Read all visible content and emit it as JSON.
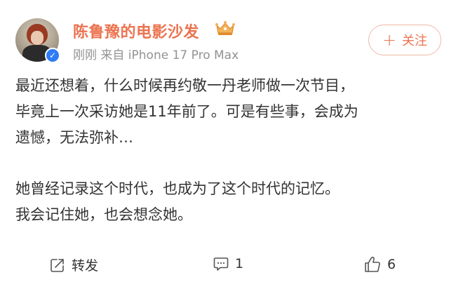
{
  "post": {
    "author": {
      "name": "陈鲁豫的电影沙发",
      "verified": true
    },
    "meta": "刚刚 来自 iPhone 17 Pro Max",
    "follow_label": "关注",
    "paragraphs": [
      "最近还想着，什么时候再约敬一丹老师做一次节目，\n毕竟上一次采访她是11年前了。可是有些事，会成为\n遗憾，无法弥补…",
      "她曾经记录这个时代，也成为了这个时代的记忆。\n我会记住她，也会想念她。"
    ]
  },
  "actions": {
    "repost_label": "转发",
    "comment_count": "1",
    "like_count": "6"
  },
  "colors": {
    "accent": "#eb7350",
    "meta_gray": "#939393",
    "text": "#333333",
    "verified_blue": "#2e7cf6"
  },
  "icons": [
    "avatar",
    "verified-icon",
    "crown-icon",
    "plus-icon",
    "repost-icon",
    "comment-icon",
    "like-icon"
  ]
}
